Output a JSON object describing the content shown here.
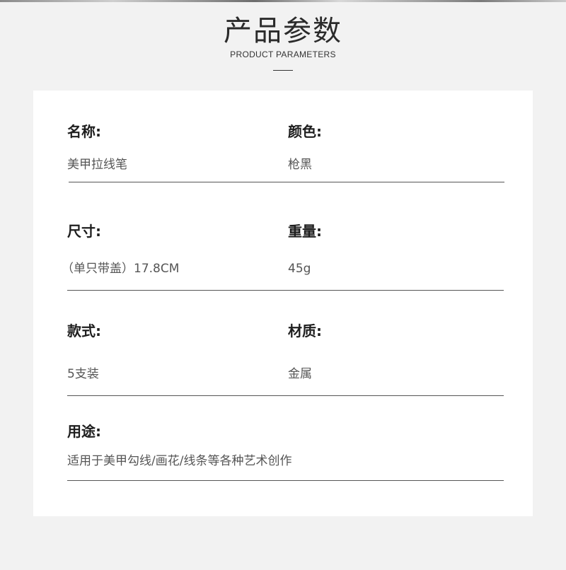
{
  "header": {
    "title": "产品参数",
    "subtitle": "PRODUCT PARAMETERS"
  },
  "params": {
    "name": {
      "label": "名称:",
      "value": "美甲拉线笔"
    },
    "color": {
      "label": "颜色:",
      "value": "枪黑"
    },
    "size": {
      "label": "尺寸:",
      "value": "（单只带盖）17.8CM"
    },
    "weight": {
      "label": "重量:",
      "value": "45g"
    },
    "style": {
      "label": "款式:",
      "value": "5支装"
    },
    "material": {
      "label": "材质:",
      "value": "金属"
    },
    "usage": {
      "label": "用途:",
      "value": "适用于美甲勾线/画花/线条等各种艺术创作"
    }
  }
}
